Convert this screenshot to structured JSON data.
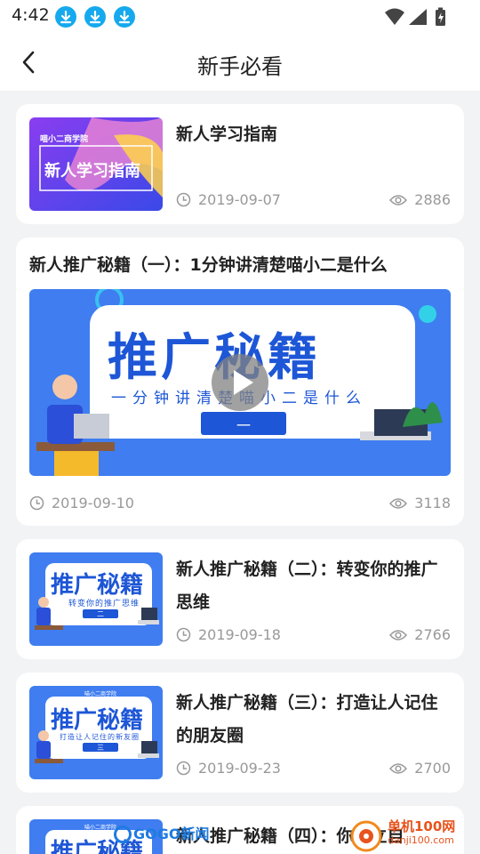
{
  "status": {
    "time": "4:42",
    "download_icons": [
      "download-icon",
      "download-icon",
      "download-icon"
    ],
    "right_icons": [
      "wifi-icon",
      "cell-signal-icon",
      "battery-icon"
    ]
  },
  "header": {
    "title": "新手必看",
    "back_icon": "chevron-left-icon"
  },
  "articles": [
    {
      "title": "新人学习指南",
      "date": "2019-09-07",
      "views": "2886",
      "thumb_brand": "喵小二商学院",
      "thumb_text": "新人学习指南"
    },
    {
      "title": "新人推广秘籍（一）：1分钟讲清楚喵小二是什么",
      "date": "2019-09-10",
      "views": "3118",
      "cover_title": "推广秘籍",
      "cover_subtitle": "一分钟讲清楚喵小二是什么",
      "cover_badge": "一"
    },
    {
      "title": "新人推广秘籍（二）：转变你的推广思维",
      "date": "2019-09-18",
      "views": "2766",
      "thumb_title": "推广秘籍",
      "thumb_subtitle": "转变你的推广思维",
      "thumb_badge": "二"
    },
    {
      "title": "新人推广秘籍（三）：打造让人记住的朋友圈",
      "date": "2019-09-23",
      "views": "2700",
      "thumb_brand": "喵小二商学院",
      "thumb_title": "推广秘籍",
      "thumb_subtitle": "打造让人记住的新友圈",
      "thumb_badge": "三"
    },
    {
      "title": "新人推广秘籍（四）：你要立自",
      "thumb_brand": "喵小二商学院",
      "thumb_title": "推广秘籍"
    }
  ],
  "watermarks": {
    "left": "GOGO新闻",
    "right_top": "单机100网",
    "right_bottom": "danji100.com"
  },
  "colors": {
    "accent": "#2f6fe8",
    "icon_blue": "#16a9ee",
    "meta_gray": "#999999",
    "background": "#f2f3f5"
  }
}
